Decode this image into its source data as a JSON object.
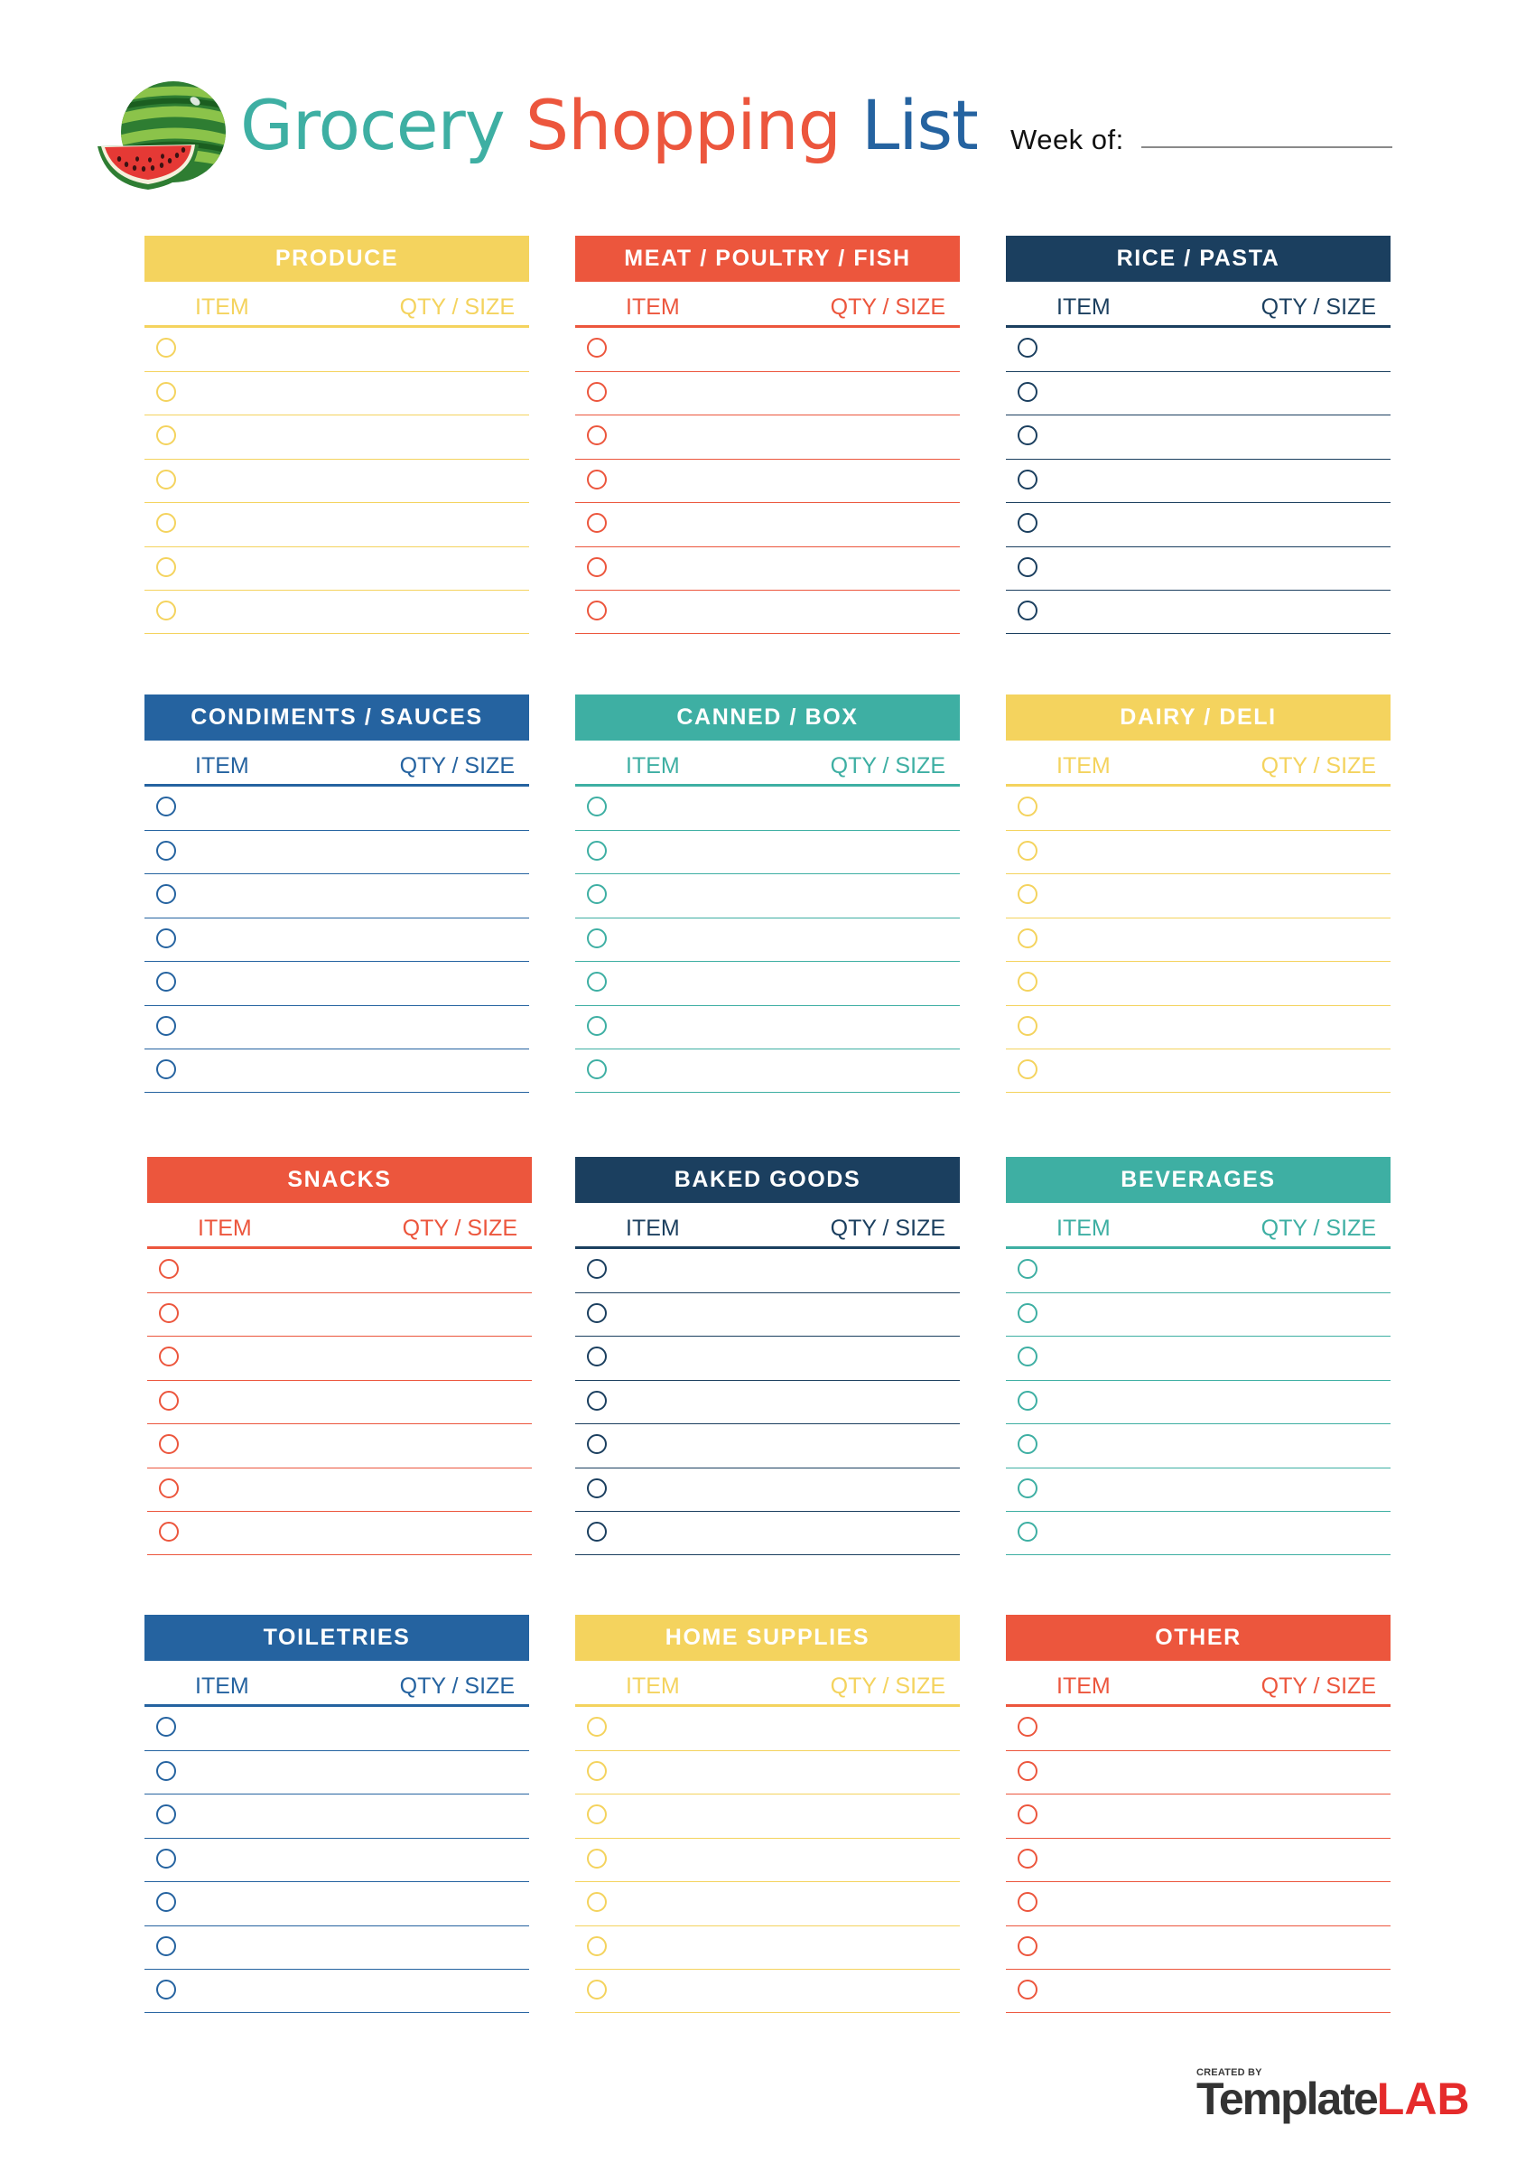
{
  "header": {
    "title_words": [
      {
        "text": "Grocery",
        "color": "#3EAFA3"
      },
      {
        "text": "Shopping",
        "color": "#EC563D"
      },
      {
        "text": "List",
        "color": "#2563A0"
      }
    ],
    "week_label": "Week of:",
    "week_value": "",
    "logo_icon": "watermelon-icon"
  },
  "colors": {
    "yellow": "#F4D35E",
    "red": "#EC563D",
    "navy": "#1B3F5F",
    "blue": "#2563A0",
    "teal": "#3EAFA3"
  },
  "column_headers": {
    "item": "ITEM",
    "qty": "QTY / SIZE"
  },
  "categories": [
    {
      "name": "PRODUCE",
      "color": "#F4D35E",
      "rows": 7
    },
    {
      "name": "MEAT / POULTRY / FISH",
      "color": "#EC563D",
      "rows": 7
    },
    {
      "name": "RICE / PASTA",
      "color": "#1B3F5F",
      "rows": 7
    },
    {
      "name": "CONDIMENTS / SAUCES",
      "color": "#2563A0",
      "rows": 7
    },
    {
      "name": "CANNED / BOX",
      "color": "#3EAFA3",
      "rows": 7
    },
    {
      "name": "DAIRY / DELI",
      "color": "#F4D35E",
      "rows": 7
    },
    {
      "name": "SNACKS",
      "color": "#EC563D",
      "rows": 7
    },
    {
      "name": "BAKED GOODS",
      "color": "#1B3F5F",
      "rows": 7
    },
    {
      "name": "BEVERAGES",
      "color": "#3EAFA3",
      "rows": 7
    },
    {
      "name": "TOILETRIES",
      "color": "#2563A0",
      "rows": 7
    },
    {
      "name": "HOME SUPPLIES",
      "color": "#F4D35E",
      "rows": 7
    },
    {
      "name": "OTHER",
      "color": "#EC563D",
      "rows": 7
    }
  ],
  "footer": {
    "created_by": "CREATED BY",
    "brand_part1": "Template",
    "brand_part2": "LAB"
  }
}
